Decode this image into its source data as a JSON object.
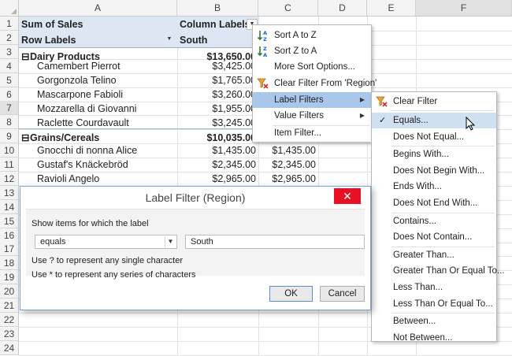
{
  "sheet": {
    "columns": [
      "A",
      "B",
      "C",
      "D",
      "E",
      "F"
    ],
    "rows": [
      "1",
      "2",
      "3",
      "4",
      "5",
      "6",
      "7",
      "8",
      "9",
      "10",
      "11",
      "12",
      "13",
      "14",
      "15",
      "16",
      "17",
      "18",
      "19",
      "20",
      "21",
      "22",
      "23",
      "24"
    ],
    "a1": "Sum of Sales",
    "b1": "Column Labels",
    "a2": "Row Labels",
    "b2": "South",
    "dairy": {
      "label": "Dairy Products",
      "collapse": "⊟",
      "value": "$13,650.00"
    },
    "dairy_items": [
      {
        "name": "Camembert Pierrot",
        "value": "$3,425.00"
      },
      {
        "name": "Gorgonzola Telino",
        "value": "$1,765.00"
      },
      {
        "name": "Mascarpone Fabioli",
        "value": "$3,260.00"
      },
      {
        "name": "Mozzarella di Giovanni",
        "value": "$1,955.00"
      },
      {
        "name": "Raclette Courdavault",
        "value": "$3,245.00"
      }
    ],
    "grains": {
      "label": "Grains/Cereals",
      "collapse": "⊟",
      "value": "$10,035.00"
    },
    "grain_items": [
      {
        "name": "Gnocchi di nonna Alice",
        "value": "$1,435.00",
        "total": "$1,435.00"
      },
      {
        "name": "Gustaf's Knäckebröd",
        "value": "$2,345.00",
        "total": "$2,345.00"
      },
      {
        "name": "Ravioli Angelo",
        "value": "$2,965.00",
        "total": "$2,965.00"
      }
    ]
  },
  "context_menu": {
    "sort_az": "Sort A to Z",
    "sort_za": "Sort Z to A",
    "more_sort": "More Sort Options...",
    "clear_filter": "Clear Filter From 'Region'",
    "label_filters": "Label Filters",
    "value_filters": "Value Filters",
    "item_filter": "Item Filter..."
  },
  "submenu": {
    "clear_filter": "Clear Filter",
    "items": [
      "Equals...",
      "Does Not Equal...",
      "Begins With...",
      "Does Not Begin With...",
      "Ends With...",
      "Does Not End With...",
      "Contains...",
      "Does Not Contain...",
      "Greater Than...",
      "Greater Than Or Equal To...",
      "Less Than...",
      "Less Than Or Equal To...",
      "Between...",
      "Not Between..."
    ],
    "checked": "Equals..."
  },
  "dialog": {
    "title": "Label Filter (Region)",
    "close": "✕",
    "instruction": "Show items for which the label",
    "operator": "equals",
    "value": "South",
    "hint1": "Use ? to represent any single character",
    "hint2": "Use * to represent any series of characters",
    "ok": "OK",
    "cancel": "Cancel"
  },
  "colors": {
    "accent": "#a9c7ea",
    "band": "#dde7f3",
    "close": "#e81123"
  }
}
